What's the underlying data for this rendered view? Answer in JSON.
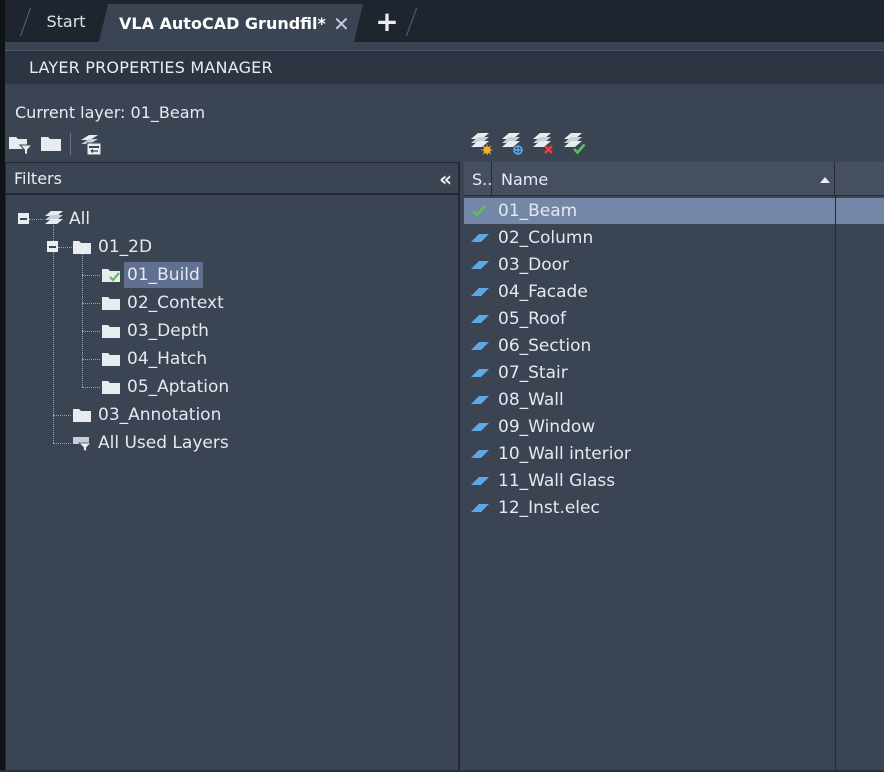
{
  "tabs": {
    "start_label": "Start",
    "active_label": "VLA AutoCAD Grundfil*",
    "close_glyph": "✕",
    "new_tab_glyph": "+"
  },
  "palette": {
    "title": "LAYER PROPERTIES MANAGER",
    "current_layer_text": "Current layer: 01_Beam"
  },
  "filters": {
    "header_label": "Filters",
    "collapse_glyph": "«",
    "tree": [
      {
        "label": "All",
        "icon": "layer-stack-icon"
      },
      {
        "label": "01_2D",
        "icon": "folder-icon"
      },
      {
        "label": "01_Build",
        "icon": "folder-check-icon",
        "selected": true
      },
      {
        "label": "02_Context",
        "icon": "folder-icon"
      },
      {
        "label": "03_Depth",
        "icon": "folder-icon"
      },
      {
        "label": "04_Hatch",
        "icon": "folder-icon"
      },
      {
        "label": "05_Aptation",
        "icon": "folder-icon"
      },
      {
        "label": "03_Annotation",
        "icon": "folder-icon"
      },
      {
        "label": "All Used Layers",
        "icon": "filter-icon"
      }
    ]
  },
  "layers": {
    "columns": {
      "status": "S..",
      "name": "Name"
    },
    "current_layer": "01_Beam",
    "rows": [
      "01_Beam",
      "02_Column",
      "03_Door",
      "04_Facade",
      "05_Roof",
      "06_Section",
      "07_Stair",
      "08_Wall",
      "09_Window",
      "10_Wall interior",
      "11_Wall Glass",
      "12_Inst.elec"
    ]
  },
  "colors": {
    "accent_check": "#5cc15a",
    "layer_icon": "#5fa8e6",
    "selection": "#7587a7"
  }
}
